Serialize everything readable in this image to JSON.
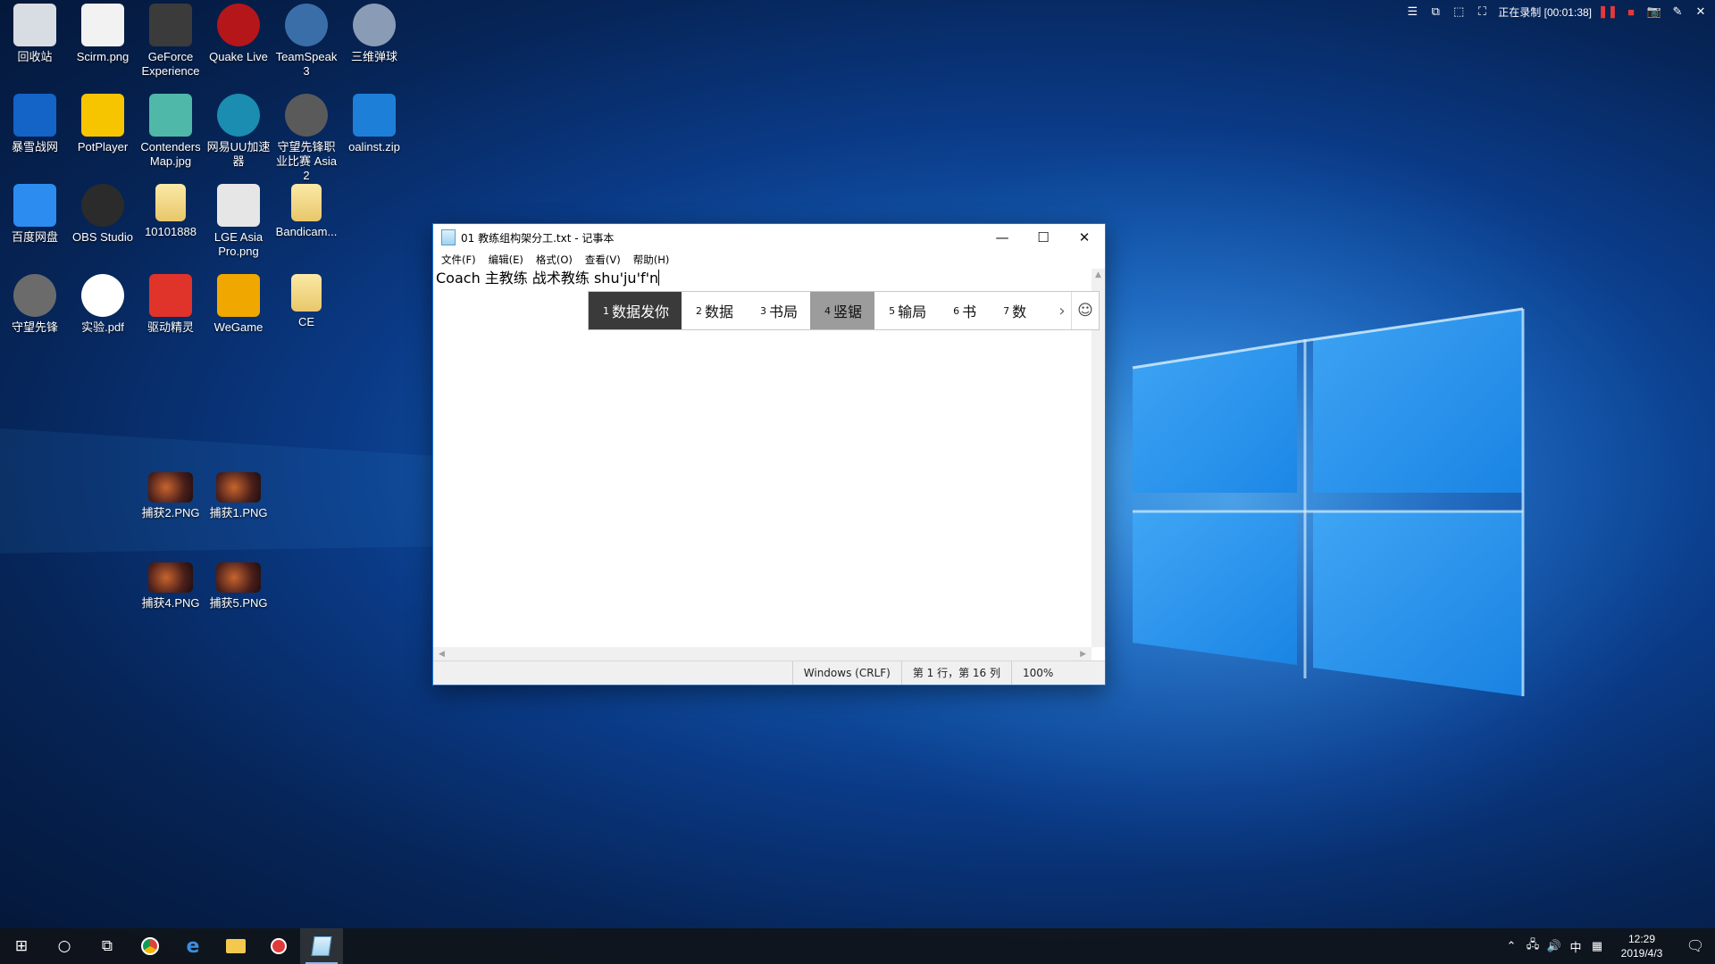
{
  "desktop_icons": [
    {
      "label": "回收站",
      "icon": "recycle-bin-icon",
      "color": "#d8dde3"
    },
    {
      "label": "Scirm.png",
      "icon": "image-file-icon",
      "color": "#f2f2f2"
    },
    {
      "label": "GeForce Experience",
      "icon": "geforce-icon",
      "color": "#3b3b3b"
    },
    {
      "label": "Quake Live",
      "icon": "quake-icon",
      "color": "#b5161a"
    },
    {
      "label": "TeamSpeak 3",
      "icon": "teamspeak-icon",
      "color": "#3a6ea8"
    },
    {
      "label": "三维弹球",
      "icon": "pinball-icon",
      "color": "#8a9bb5"
    },
    {
      "label": "暴雪战网",
      "icon": "battlenet-icon",
      "color": "#1463c7"
    },
    {
      "label": "PotPlayer",
      "icon": "potplayer-icon",
      "color": "#f7c500"
    },
    {
      "label": "Contenders Map.jpg",
      "icon": "image-file-icon",
      "color": "#4fb8a8"
    },
    {
      "label": "网易UU加速器",
      "icon": "uu-accelerator-icon",
      "color": "#1a8db0"
    },
    {
      "label": "守望先锋职业比赛 Asia 2",
      "icon": "overwatch-icon",
      "color": "#5a5a5a"
    },
    {
      "label": "oalinst.zip",
      "icon": "zip-file-icon",
      "color": "#1e7fd8"
    },
    {
      "label": "百度网盘",
      "icon": "baidu-netdisk-icon",
      "color": "#2d8cf0"
    },
    {
      "label": "OBS Studio",
      "icon": "obs-icon",
      "color": "#2b2b2b"
    },
    {
      "label": "10101888",
      "icon": "folder-icon",
      "color": "#e8c76a"
    },
    {
      "label": "LGE Asia Pro.png",
      "icon": "image-file-icon",
      "color": "#e6e6e6"
    },
    {
      "label": "Bandicam...",
      "icon": "folder-icon",
      "color": "#e8c76a"
    },
    {
      "label": "守望先锋",
      "icon": "overwatch-icon",
      "color": "#6b6b6b"
    },
    {
      "label": "实验.pdf",
      "icon": "chrome-icon",
      "color": "#ffffff"
    },
    {
      "label": "驱动精灵",
      "icon": "driver-genius-icon",
      "color": "#e0332a"
    },
    {
      "label": "WeGame",
      "icon": "wegame-icon",
      "color": "#f0a800"
    },
    {
      "label": "CE",
      "icon": "folder-icon",
      "color": "#e8c76a"
    },
    {
      "label": "捕获2.PNG",
      "icon": "image-thumbnail-icon",
      "color": "#7a3020"
    },
    {
      "label": "捕获1.PNG",
      "icon": "image-thumbnail-icon",
      "color": "#7a3020"
    },
    {
      "label": "捕获4.PNG",
      "icon": "image-thumbnail-icon",
      "color": "#7a3020"
    },
    {
      "label": "捕获5.PNG",
      "icon": "image-thumbnail-icon",
      "color": "#7a3020"
    }
  ],
  "recorder": {
    "status": "正在录制 [00:01:38]",
    "icons": [
      "menu-icon",
      "window-icon",
      "region-icon",
      "fullscreen-icon",
      "pause-icon",
      "stop-icon",
      "camera-icon",
      "pen-icon",
      "close-icon"
    ]
  },
  "notepad": {
    "title": "01 教练组构架分工.txt - 记事本",
    "menu": [
      "文件(F)",
      "编辑(E)",
      "格式(O)",
      "查看(V)",
      "帮助(H)"
    ],
    "content": "Coach 主教练 战术教练 shu'ju'f'n",
    "status": {
      "encoding": "Windows (CRLF)",
      "position": "第 1 行，第 16 列",
      "zoom": "100%"
    }
  },
  "ime": {
    "candidates": [
      {
        "num": "1",
        "text": "数据发你"
      },
      {
        "num": "2",
        "text": "数据"
      },
      {
        "num": "3",
        "text": "书局"
      },
      {
        "num": "4",
        "text": "竖锯"
      },
      {
        "num": "5",
        "text": "输局"
      },
      {
        "num": "6",
        "text": "书"
      },
      {
        "num": "7",
        "text": "数"
      }
    ],
    "highlighted_index": 3,
    "colors": {
      "first": "#3a3a3a",
      "selected": "#9c9c9c"
    }
  },
  "taskbar": {
    "items": [
      "windows-start-icon",
      "search-icon",
      "task-view-icon",
      "chrome-icon",
      "edge-icon",
      "file-explorer-icon",
      "record-icon",
      "notepad-icon"
    ],
    "tray": {
      "ime_mode": "中",
      "time": "12:29",
      "date": "2019/4/3"
    }
  }
}
